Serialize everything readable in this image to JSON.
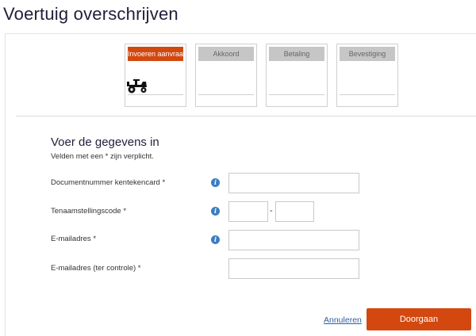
{
  "page": {
    "title": "Voertuig overschrijven"
  },
  "steps": [
    {
      "label": "Invoeren aanvraag",
      "active": true,
      "icon": "tractor-icon"
    },
    {
      "label": "Akkoord",
      "active": false
    },
    {
      "label": "Betaling",
      "active": false
    },
    {
      "label": "Bevestiging",
      "active": false
    }
  ],
  "form": {
    "title": "Voer de gegevens in",
    "required_note": "Velden met een * zijn verplicht.",
    "fields": {
      "document_number": {
        "label": "Documentnummer kentekencard *",
        "value": "",
        "info_icon": "info-icon"
      },
      "registration_code": {
        "label": "Tenaamstellingscode *",
        "value_part1": "",
        "value_part2": "",
        "separator": "-",
        "info_icon": "info-icon"
      },
      "email": {
        "label": "E-mailadres *",
        "value": "",
        "info_icon": "info-icon"
      },
      "email_confirm": {
        "label": "E-mailadres (ter controle) *",
        "value": ""
      }
    }
  },
  "actions": {
    "cancel_label": "Annuleren",
    "continue_label": "Doorgaan"
  },
  "colors": {
    "accent": "#d3480f",
    "step_inactive": "#c6c6c6",
    "info": "#3a7ec1",
    "link": "#2b5f9e"
  }
}
